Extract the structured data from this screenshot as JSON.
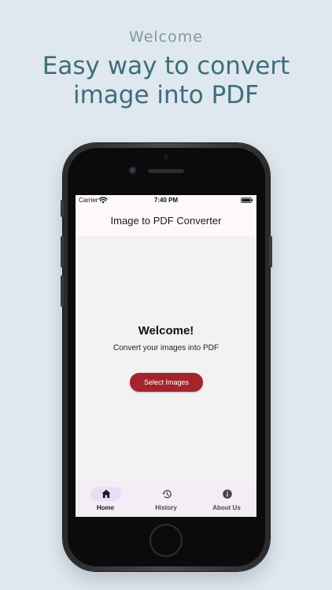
{
  "promo": {
    "eyebrow": "Welcome",
    "headline_line1": "Easy way to convert",
    "headline_line2": "image into PDF"
  },
  "status_bar": {
    "carrier": "Carrier",
    "time": "7:40 PM",
    "icons": [
      "wifi-icon",
      "battery-icon"
    ]
  },
  "app_bar": {
    "title": "Image to PDF Converter"
  },
  "main": {
    "heading": "Welcome!",
    "subtitle": "Convert your images into PDF",
    "select_button_label": "Select Images"
  },
  "bottom_nav": {
    "items": [
      {
        "label": "Home",
        "icon": "home-icon",
        "selected": true
      },
      {
        "label": "History",
        "icon": "history-icon",
        "selected": false
      },
      {
        "label": "About Us",
        "icon": "info-icon",
        "selected": false
      }
    ]
  },
  "colors": {
    "background": "#dfe8ef",
    "headline": "#3f6d7c",
    "eyebrow": "#7f99a4",
    "primary_button": "#a4242c",
    "nav_background": "#f3edf6",
    "nav_selected_pill": "#e8def8",
    "app_bar": "#fdf8fc"
  }
}
